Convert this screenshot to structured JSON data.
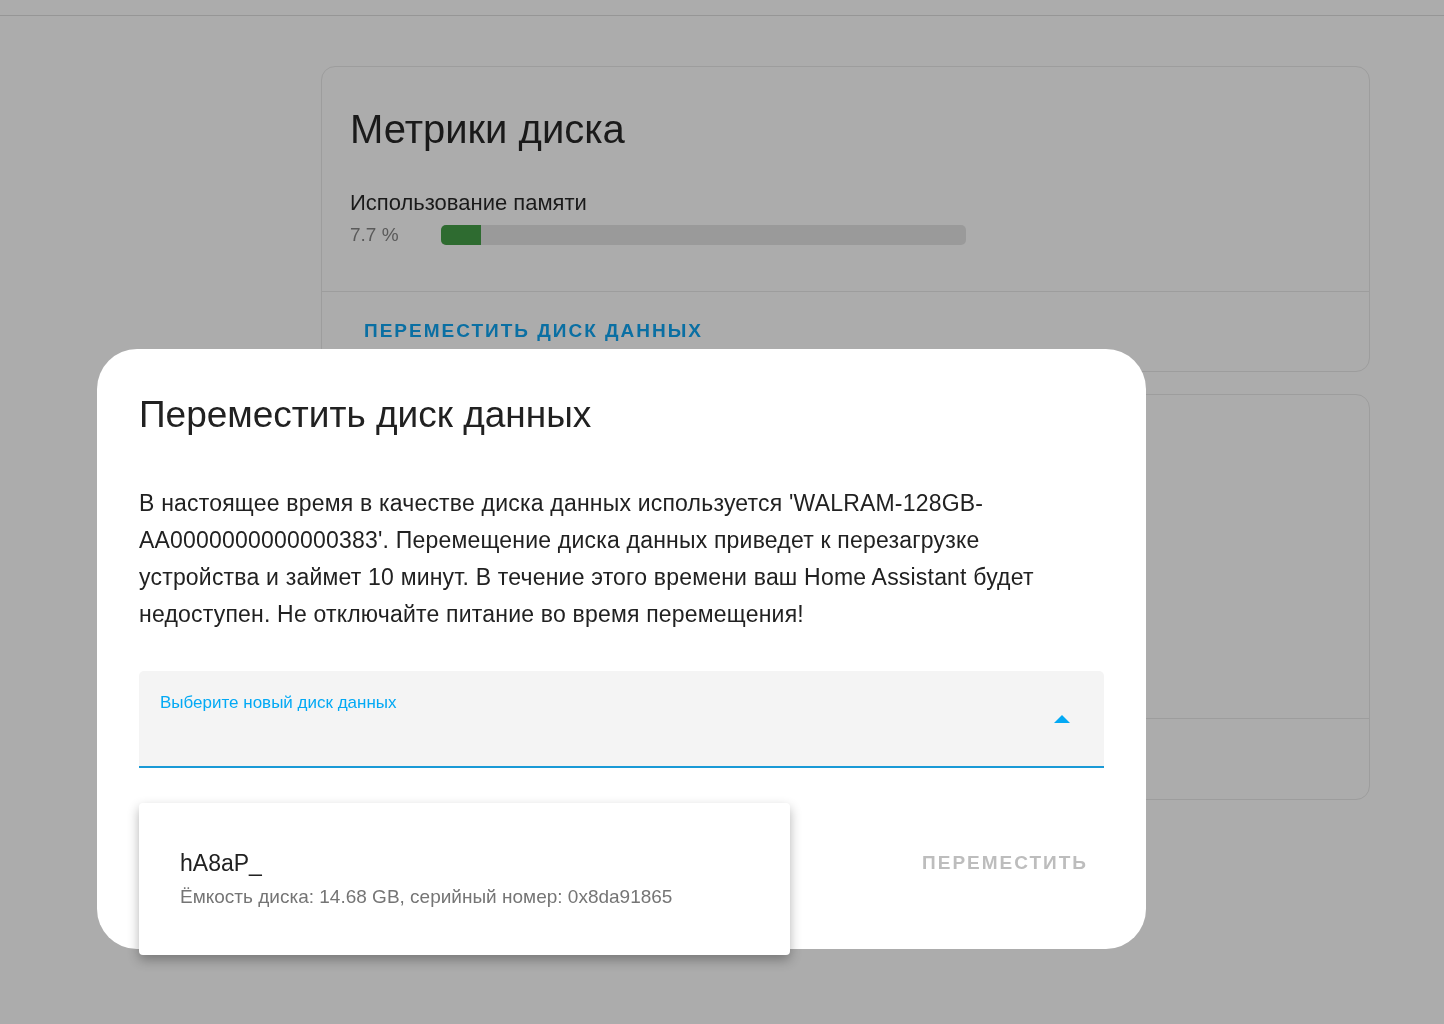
{
  "card": {
    "title": "Метрики диска",
    "metric": {
      "label": "Использование памяти",
      "reading": "7.7 %",
      "level": 0.077
    },
    "action": "ПЕРЕМЕСТИТЬ ДИСК ДАННЫХ"
  },
  "dialog": {
    "title": "Переместить диск данных",
    "message": "В настоящее время в качестве диска данных используется 'WALRAM-128GB-AA0000000000000383'. Перемещение диска данных приведет к перезагрузке устройства и займет 10 минут. В течение этого времени ваш Home Assistant будет недоступен. Не отключайте питание во время перемещения!",
    "select": {
      "label": "Выберите новый диск данных",
      "expanded": true,
      "options": [
        {
          "name": "hA8aP_",
          "detail": "Ёмкость диска: 14.68 GB, серийный номер: 0x8da91865",
          "selected": false
        }
      ]
    },
    "button": {
      "label": "ПЕРЕМЕСТИТЬ",
      "disabled": true
    }
  }
}
